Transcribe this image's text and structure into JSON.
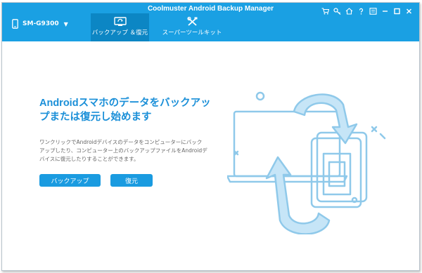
{
  "window": {
    "title": "Coolmuster Android Backup Manager"
  },
  "device": {
    "name": "SM-G9300",
    "icon": "phone-icon",
    "caret": "▼"
  },
  "tabs": [
    {
      "label": "バックアップ ＆復元",
      "icon": "backup-restore-icon",
      "active": true
    },
    {
      "label": "スーパーツールキット",
      "icon": "tools-icon",
      "active": false
    }
  ],
  "window_controls": [
    "cart-icon",
    "key-icon",
    "home-icon",
    "help-icon",
    "feedback-icon",
    "minimize-icon",
    "maximize-icon",
    "close-icon"
  ],
  "main": {
    "headline_line1": "Androidスマホのデータをバックアッ",
    "headline_line2": "プまたは復元し始めます",
    "description_line1": "ワンクリックでAndroidデバイスのデータをコンピューターにバック",
    "description_line2": "アップしたり、コンピューター上のバックアップファイルをAndroidデ",
    "description_line3": "バイスに復元したりすることができます。",
    "backup_button": "バックアップ",
    "restore_button": "復元"
  },
  "colors": {
    "accent": "#1aa0e3",
    "active_tab": "#0c86c4",
    "headline": "#1a8fd8",
    "illustration": "#8fc9ea"
  }
}
